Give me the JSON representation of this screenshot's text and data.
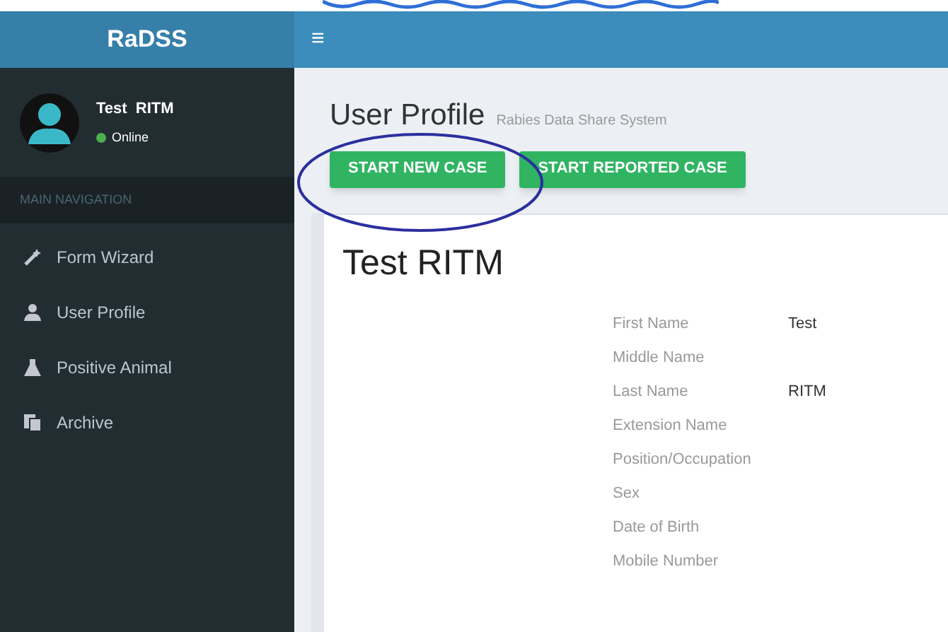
{
  "header": {
    "logo": "RaDSS",
    "menu_toggle": "≡"
  },
  "user_panel": {
    "name": "Test  RITM",
    "status": "Online"
  },
  "sidebar": {
    "heading": "MAIN NAVIGATION",
    "items": [
      {
        "label": "Form Wizard",
        "selected": false
      },
      {
        "label": "User Profile",
        "selected": false
      },
      {
        "label": "Positive Animal",
        "selected": false
      },
      {
        "label": "Archive",
        "selected": false
      }
    ]
  },
  "page": {
    "title": "User Profile",
    "subtitle": "Rabies Data Share System",
    "buttons": [
      "START NEW CASE",
      "START REPORTED CASE"
    ]
  },
  "profile": {
    "name": "Test RITM",
    "fields": [
      {
        "label": "First Name",
        "value": "Test"
      },
      {
        "label": "Middle Name"
      },
      {
        "label": "Last Name",
        "value": "RITM"
      },
      {
        "label": "Extension Name"
      },
      {
        "label": "Position/Occupation"
      },
      {
        "label": "Sex"
      },
      {
        "label": "Date of Birth"
      },
      {
        "label": "Mobile Number"
      }
    ]
  }
}
